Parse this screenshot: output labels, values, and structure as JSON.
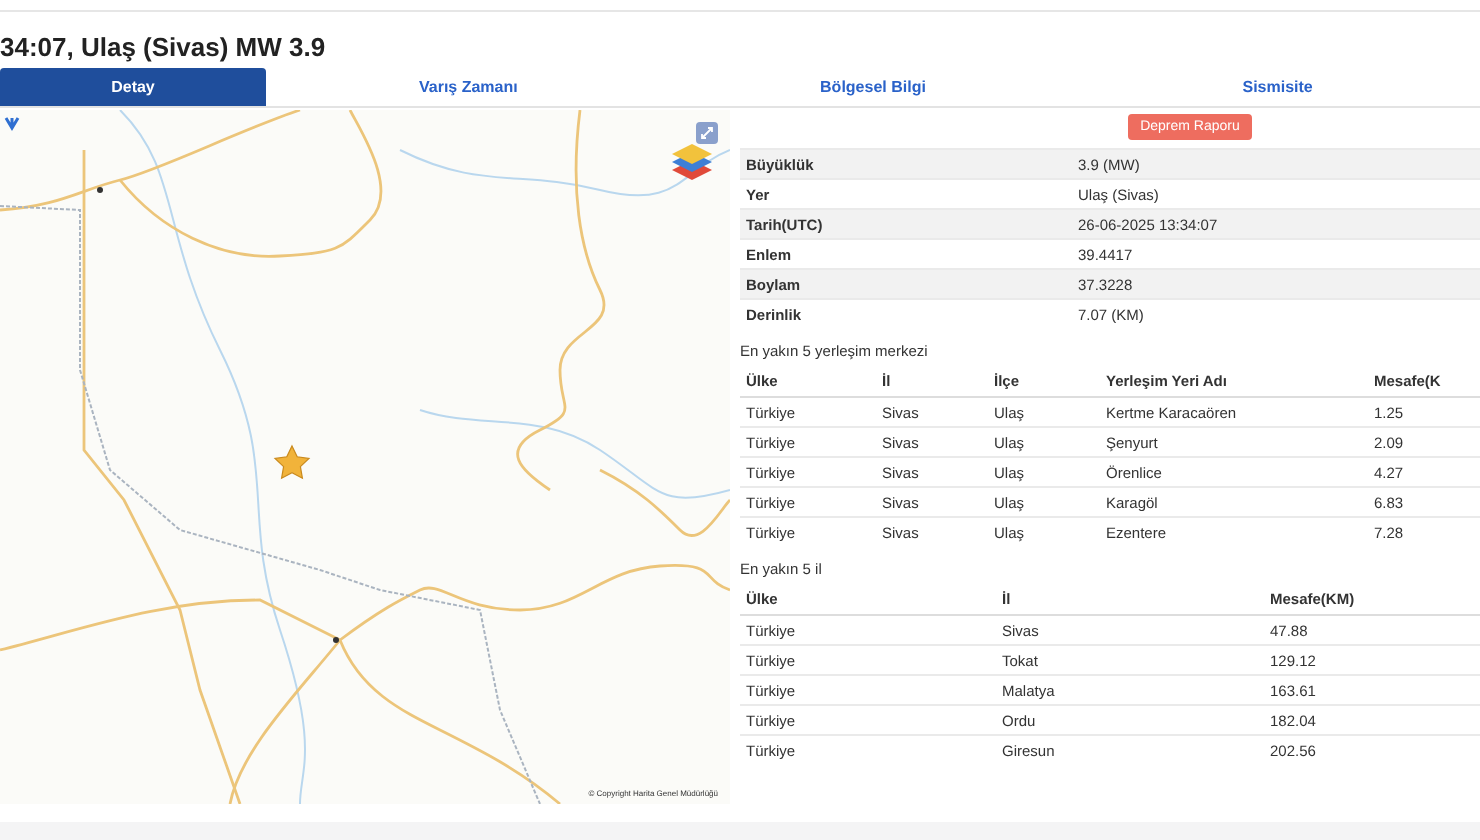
{
  "title": "34:07, Ulaş (Sivas) MW 3.9",
  "tabs": [
    {
      "label": "Detay",
      "selected": true
    },
    {
      "label": "Varış Zamanı",
      "selected": false
    },
    {
      "label": "Bölgesel Bilgi",
      "selected": false
    },
    {
      "label": "Sismisite",
      "selected": false
    }
  ],
  "map": {
    "attribution": "© Copyright Harita Genel Müdürlüğü"
  },
  "report_button": "Deprem Raporu",
  "details": [
    {
      "label": "Büyüklük",
      "value": "3.9 (MW)"
    },
    {
      "label": "Yer",
      "value": "Ulaş (Sivas)"
    },
    {
      "label": "Tarih(UTC)",
      "value": "26-06-2025 13:34:07"
    },
    {
      "label": "Enlem",
      "value": "39.4417"
    },
    {
      "label": "Boylam",
      "value": "37.3228"
    },
    {
      "label": "Derinlik",
      "value": "7.07 (KM)"
    }
  ],
  "settlements": {
    "title": "En yakın 5 yerleşim merkezi",
    "columns": [
      "Ülke",
      "İl",
      "İlçe",
      "Yerleşim Yeri Adı",
      "Mesafe(K"
    ],
    "rows": [
      [
        "Türkiye",
        "Sivas",
        "Ulaş",
        "Kertme Karacaören",
        "1.25"
      ],
      [
        "Türkiye",
        "Sivas",
        "Ulaş",
        "Şenyurt",
        "2.09"
      ],
      [
        "Türkiye",
        "Sivas",
        "Ulaş",
        "Örenlice",
        "4.27"
      ],
      [
        "Türkiye",
        "Sivas",
        "Ulaş",
        "Karagöl",
        "6.83"
      ],
      [
        "Türkiye",
        "Sivas",
        "Ulaş",
        "Ezentere",
        "7.28"
      ]
    ]
  },
  "provinces": {
    "title": "En yakın 5 il",
    "columns": [
      "Ülke",
      "İl",
      "Mesafe(KM)"
    ],
    "rows": [
      [
        "Türkiye",
        "Sivas",
        "47.88"
      ],
      [
        "Türkiye",
        "Tokat",
        "129.12"
      ],
      [
        "Türkiye",
        "Malatya",
        "163.61"
      ],
      [
        "Türkiye",
        "Ordu",
        "182.04"
      ],
      [
        "Türkiye",
        "Giresun",
        "202.56"
      ]
    ]
  }
}
